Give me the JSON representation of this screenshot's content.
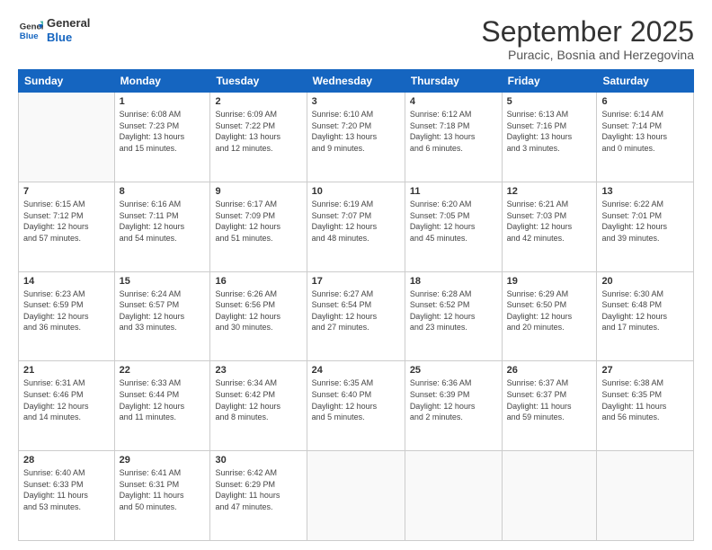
{
  "logo": {
    "line1": "General",
    "line2": "Blue"
  },
  "title": "September 2025",
  "subtitle": "Puracic, Bosnia and Herzegovina",
  "header_days": [
    "Sunday",
    "Monday",
    "Tuesday",
    "Wednesday",
    "Thursday",
    "Friday",
    "Saturday"
  ],
  "weeks": [
    [
      {
        "day": "",
        "info": ""
      },
      {
        "day": "1",
        "info": "Sunrise: 6:08 AM\nSunset: 7:23 PM\nDaylight: 13 hours\nand 15 minutes."
      },
      {
        "day": "2",
        "info": "Sunrise: 6:09 AM\nSunset: 7:22 PM\nDaylight: 13 hours\nand 12 minutes."
      },
      {
        "day": "3",
        "info": "Sunrise: 6:10 AM\nSunset: 7:20 PM\nDaylight: 13 hours\nand 9 minutes."
      },
      {
        "day": "4",
        "info": "Sunrise: 6:12 AM\nSunset: 7:18 PM\nDaylight: 13 hours\nand 6 minutes."
      },
      {
        "day": "5",
        "info": "Sunrise: 6:13 AM\nSunset: 7:16 PM\nDaylight: 13 hours\nand 3 minutes."
      },
      {
        "day": "6",
        "info": "Sunrise: 6:14 AM\nSunset: 7:14 PM\nDaylight: 13 hours\nand 0 minutes."
      }
    ],
    [
      {
        "day": "7",
        "info": "Sunrise: 6:15 AM\nSunset: 7:12 PM\nDaylight: 12 hours\nand 57 minutes."
      },
      {
        "day": "8",
        "info": "Sunrise: 6:16 AM\nSunset: 7:11 PM\nDaylight: 12 hours\nand 54 minutes."
      },
      {
        "day": "9",
        "info": "Sunrise: 6:17 AM\nSunset: 7:09 PM\nDaylight: 12 hours\nand 51 minutes."
      },
      {
        "day": "10",
        "info": "Sunrise: 6:19 AM\nSunset: 7:07 PM\nDaylight: 12 hours\nand 48 minutes."
      },
      {
        "day": "11",
        "info": "Sunrise: 6:20 AM\nSunset: 7:05 PM\nDaylight: 12 hours\nand 45 minutes."
      },
      {
        "day": "12",
        "info": "Sunrise: 6:21 AM\nSunset: 7:03 PM\nDaylight: 12 hours\nand 42 minutes."
      },
      {
        "day": "13",
        "info": "Sunrise: 6:22 AM\nSunset: 7:01 PM\nDaylight: 12 hours\nand 39 minutes."
      }
    ],
    [
      {
        "day": "14",
        "info": "Sunrise: 6:23 AM\nSunset: 6:59 PM\nDaylight: 12 hours\nand 36 minutes."
      },
      {
        "day": "15",
        "info": "Sunrise: 6:24 AM\nSunset: 6:57 PM\nDaylight: 12 hours\nand 33 minutes."
      },
      {
        "day": "16",
        "info": "Sunrise: 6:26 AM\nSunset: 6:56 PM\nDaylight: 12 hours\nand 30 minutes."
      },
      {
        "day": "17",
        "info": "Sunrise: 6:27 AM\nSunset: 6:54 PM\nDaylight: 12 hours\nand 27 minutes."
      },
      {
        "day": "18",
        "info": "Sunrise: 6:28 AM\nSunset: 6:52 PM\nDaylight: 12 hours\nand 23 minutes."
      },
      {
        "day": "19",
        "info": "Sunrise: 6:29 AM\nSunset: 6:50 PM\nDaylight: 12 hours\nand 20 minutes."
      },
      {
        "day": "20",
        "info": "Sunrise: 6:30 AM\nSunset: 6:48 PM\nDaylight: 12 hours\nand 17 minutes."
      }
    ],
    [
      {
        "day": "21",
        "info": "Sunrise: 6:31 AM\nSunset: 6:46 PM\nDaylight: 12 hours\nand 14 minutes."
      },
      {
        "day": "22",
        "info": "Sunrise: 6:33 AM\nSunset: 6:44 PM\nDaylight: 12 hours\nand 11 minutes."
      },
      {
        "day": "23",
        "info": "Sunrise: 6:34 AM\nSunset: 6:42 PM\nDaylight: 12 hours\nand 8 minutes."
      },
      {
        "day": "24",
        "info": "Sunrise: 6:35 AM\nSunset: 6:40 PM\nDaylight: 12 hours\nand 5 minutes."
      },
      {
        "day": "25",
        "info": "Sunrise: 6:36 AM\nSunset: 6:39 PM\nDaylight: 12 hours\nand 2 minutes."
      },
      {
        "day": "26",
        "info": "Sunrise: 6:37 AM\nSunset: 6:37 PM\nDaylight: 11 hours\nand 59 minutes."
      },
      {
        "day": "27",
        "info": "Sunrise: 6:38 AM\nSunset: 6:35 PM\nDaylight: 11 hours\nand 56 minutes."
      }
    ],
    [
      {
        "day": "28",
        "info": "Sunrise: 6:40 AM\nSunset: 6:33 PM\nDaylight: 11 hours\nand 53 minutes."
      },
      {
        "day": "29",
        "info": "Sunrise: 6:41 AM\nSunset: 6:31 PM\nDaylight: 11 hours\nand 50 minutes."
      },
      {
        "day": "30",
        "info": "Sunrise: 6:42 AM\nSunset: 6:29 PM\nDaylight: 11 hours\nand 47 minutes."
      },
      {
        "day": "",
        "info": ""
      },
      {
        "day": "",
        "info": ""
      },
      {
        "day": "",
        "info": ""
      },
      {
        "day": "",
        "info": ""
      }
    ]
  ]
}
